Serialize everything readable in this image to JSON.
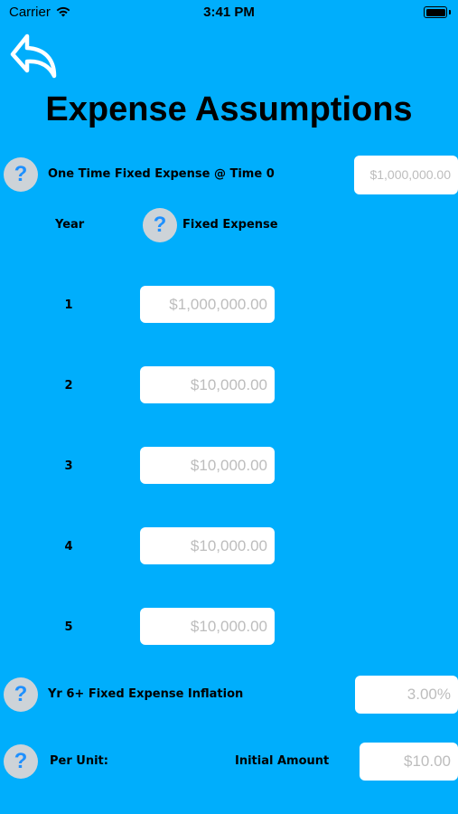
{
  "status_bar": {
    "carrier": "Carrier",
    "time": "3:41 PM"
  },
  "header": {
    "title": "Expense Assumptions",
    "back_icon": "back-arrow-icon"
  },
  "help_icon_glyph": "?",
  "one_time": {
    "label": "One Time Fixed Expense @ Time 0",
    "placeholder": "$1,000,000.00"
  },
  "table": {
    "year_header": "Year",
    "expense_header": "Fixed Expense",
    "rows": [
      {
        "year": "1",
        "placeholder": "$1,000,000.00"
      },
      {
        "year": "2",
        "placeholder": "$10,000.00"
      },
      {
        "year": "3",
        "placeholder": "$10,000.00"
      },
      {
        "year": "4",
        "placeholder": "$10,000.00"
      },
      {
        "year": "5",
        "placeholder": "$10,000.00"
      }
    ]
  },
  "inflation": {
    "label": "Yr 6+ Fixed Expense Inflation",
    "placeholder": "3.00%"
  },
  "per_unit": {
    "label": "Per Unit:",
    "initial_label": "Initial Amount",
    "placeholder": "$10.00"
  }
}
